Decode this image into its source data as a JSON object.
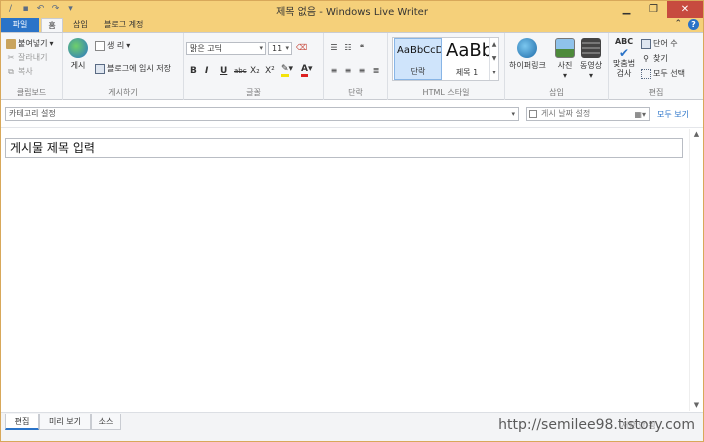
{
  "window": {
    "title": "제목 없음 - Windows Live Writer"
  },
  "ribbon_tabs": {
    "file": "파일",
    "home": "홈",
    "insert": "삽입",
    "account": "블로그 계정"
  },
  "clipboard": {
    "paste": "붙여넣기",
    "cut": "잘라내기",
    "copy": "복사",
    "label": "클립보드"
  },
  "publish": {
    "publish": "게시",
    "new": "생 리",
    "draft": "블로그에 임시 저장",
    "label": "게시하기"
  },
  "font": {
    "face": "맑은 고딕",
    "size": "11",
    "label": "글꼴",
    "bold": "B",
    "italic": "I",
    "underline": "U",
    "strike": "abc",
    "sub": "X₂",
    "sup": "X²"
  },
  "paragraph": {
    "label": "단락"
  },
  "html_style": {
    "style1_sample": "AaBbCcDd",
    "style1_name": "단락",
    "style2_sample": "AaBb",
    "style2_name": "제목 1",
    "label": "HTML 스타일"
  },
  "insert": {
    "hyperlink": "하이퍼링크",
    "picture": "사진",
    "video": "동영상",
    "label": "삽입"
  },
  "editing": {
    "spell_check_line1": "맞춤법",
    "spell_check_line2": "검사",
    "word_count": "단어 수",
    "find": "찾기",
    "select_all": "모두 선택",
    "label": "편집"
  },
  "category": {
    "placeholder": "카테고리 설정"
  },
  "publish_date": {
    "placeholder": "게시 날짜 설정"
  },
  "view_all": "모두 보기",
  "post": {
    "title": "게시물 제목 입력"
  },
  "bottom_tabs": {
    "edit": "편집",
    "preview": "미리 보기",
    "source": "소스"
  },
  "status": {
    "text": "저장 안 됨"
  },
  "watermark": "http://semilee98.tistory.com",
  "colors": {
    "accent": "#2a73c8",
    "titlebar": "#f5d07a",
    "close": "#c74b3f"
  }
}
